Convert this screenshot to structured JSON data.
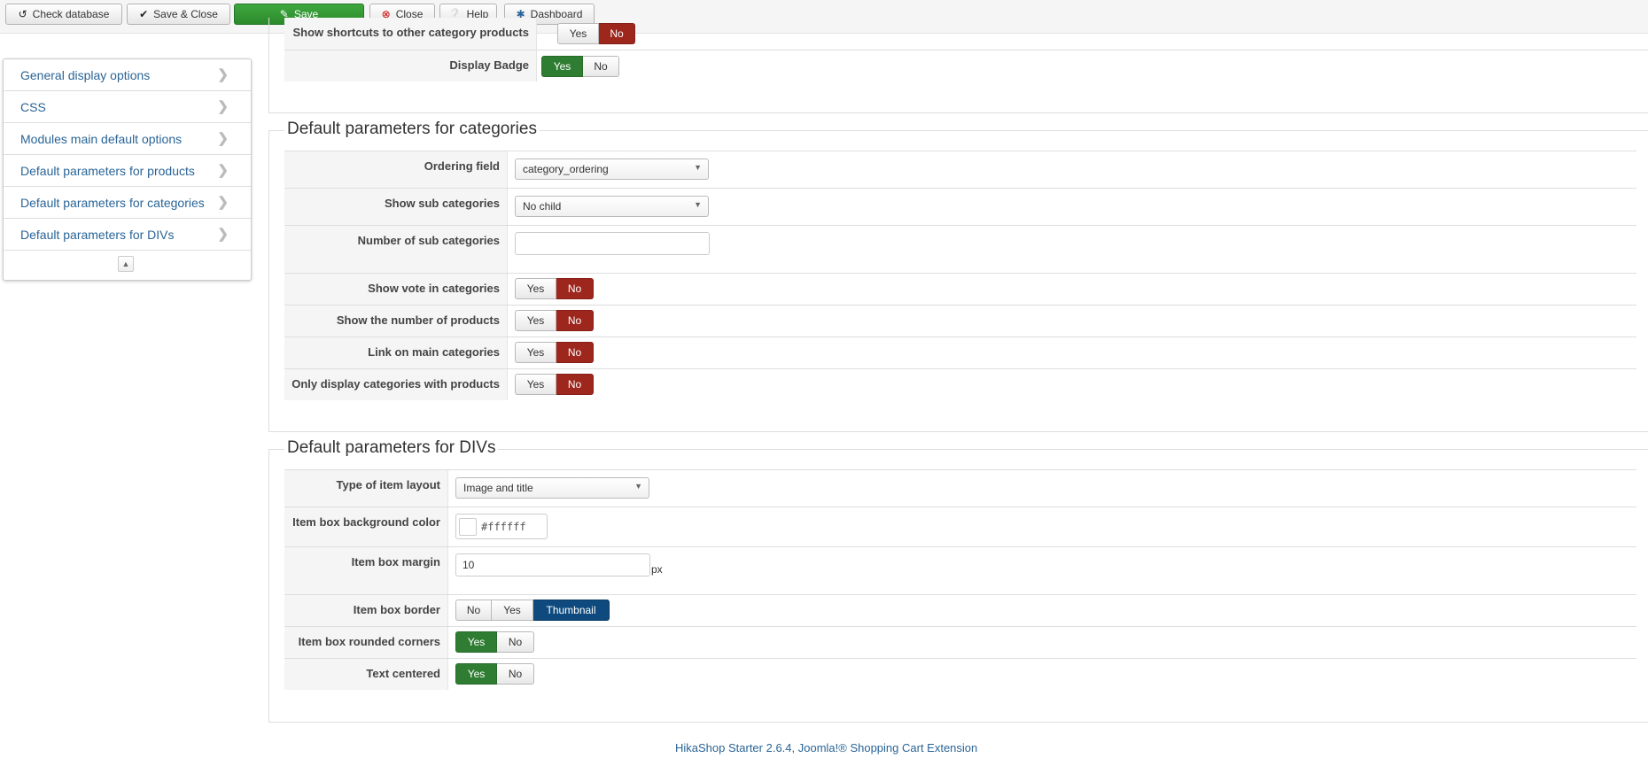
{
  "toolbar": {
    "check_database": "Check database",
    "save_close": "Save & Close",
    "save": "Save",
    "close": "Close",
    "help": "Help",
    "dashboard": "Dashboard"
  },
  "sidebar": {
    "items": [
      {
        "label": "General display options"
      },
      {
        "label": "CSS"
      },
      {
        "label": "Modules main default options"
      },
      {
        "label": "Default parameters for products"
      },
      {
        "label": "Default parameters for categories"
      },
      {
        "label": "Default parameters for DIVs"
      }
    ]
  },
  "products": {
    "rows": [
      {
        "label": "Show shortcuts to other category products",
        "yes": "Yes",
        "no": "No",
        "value": "No"
      },
      {
        "label": "Display Badge",
        "yes": "Yes",
        "no": "No",
        "value": "Yes"
      }
    ]
  },
  "categories": {
    "title": "Default parameters for categories",
    "ordering_field": {
      "label": "Ordering field",
      "value": "category_ordering"
    },
    "show_sub_categories": {
      "label": "Show sub categories",
      "value": "No child"
    },
    "number_sub_categories": {
      "label": "Number of sub categories",
      "value": ""
    },
    "toggles": [
      {
        "label": "Show vote in categories",
        "yes": "Yes",
        "no": "No",
        "value": "No"
      },
      {
        "label": "Show the number of products",
        "yes": "Yes",
        "no": "No",
        "value": "No"
      },
      {
        "label": "Link on main categories",
        "yes": "Yes",
        "no": "No",
        "value": "No"
      },
      {
        "label": "Only display categories with products",
        "yes": "Yes",
        "no": "No",
        "value": "No"
      }
    ]
  },
  "divs": {
    "title": "Default parameters for DIVs",
    "layout": {
      "label": "Type of item layout",
      "value": "Image and title"
    },
    "bg_color": {
      "label": "Item box background color",
      "value": "#ffffff",
      "swatch": "#ffffff"
    },
    "margin": {
      "label": "Item box margin",
      "value": "10",
      "unit": "px"
    },
    "border": {
      "label": "Item box border",
      "options": [
        "No",
        "Yes",
        "Thumbnail"
      ],
      "value": "Thumbnail"
    },
    "rounded": {
      "label": "Item box rounded corners",
      "yes": "Yes",
      "no": "No",
      "value": "Yes"
    },
    "centered": {
      "label": "Text centered",
      "yes": "Yes",
      "no": "No",
      "value": "Yes"
    }
  },
  "footer": "HikaShop Starter 2.6.4, Joomla!® Shopping Cart Extension",
  "colors": {
    "green": "#2f7d32",
    "red": "#9d261d",
    "blue": "#0e4a7e",
    "link": "#2a6496"
  }
}
